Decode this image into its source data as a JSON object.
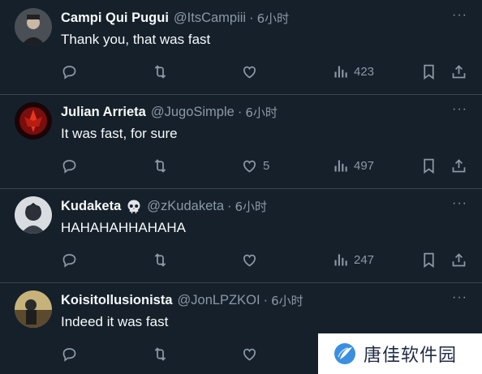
{
  "tweets": [
    {
      "name": "Campi Qui Pugui",
      "handle": "@ItsCampiii",
      "dot": "·",
      "time": "6小时",
      "text": "Thank you, that was fast",
      "likes": "",
      "views": "423",
      "more": "···"
    },
    {
      "name": "Julian Arrieta",
      "handle": "@JugoSimple",
      "dot": "·",
      "time": "6小时",
      "text": "It was fast, for sure",
      "likes": "5",
      "views": "497",
      "more": "···"
    },
    {
      "name": "Kudaketa",
      "name_emoji": "skull-icon",
      "handle": "@zKudaketa",
      "dot": "·",
      "time": "6小时",
      "text": "HAHAHAHHAHAHA",
      "likes": "",
      "views": "247",
      "more": "···"
    },
    {
      "name": "Koisitollusionista",
      "handle": "@JonLPZKOI",
      "dot": "·",
      "time": "6小时",
      "text": "Indeed it was fast",
      "likes": "",
      "views": "",
      "more": "···"
    }
  ],
  "watermark": {
    "text": "唐佳软件园"
  },
  "colors": {
    "background": "#15202b",
    "secondary_text": "#8b98a5",
    "divider": "#38444d"
  }
}
